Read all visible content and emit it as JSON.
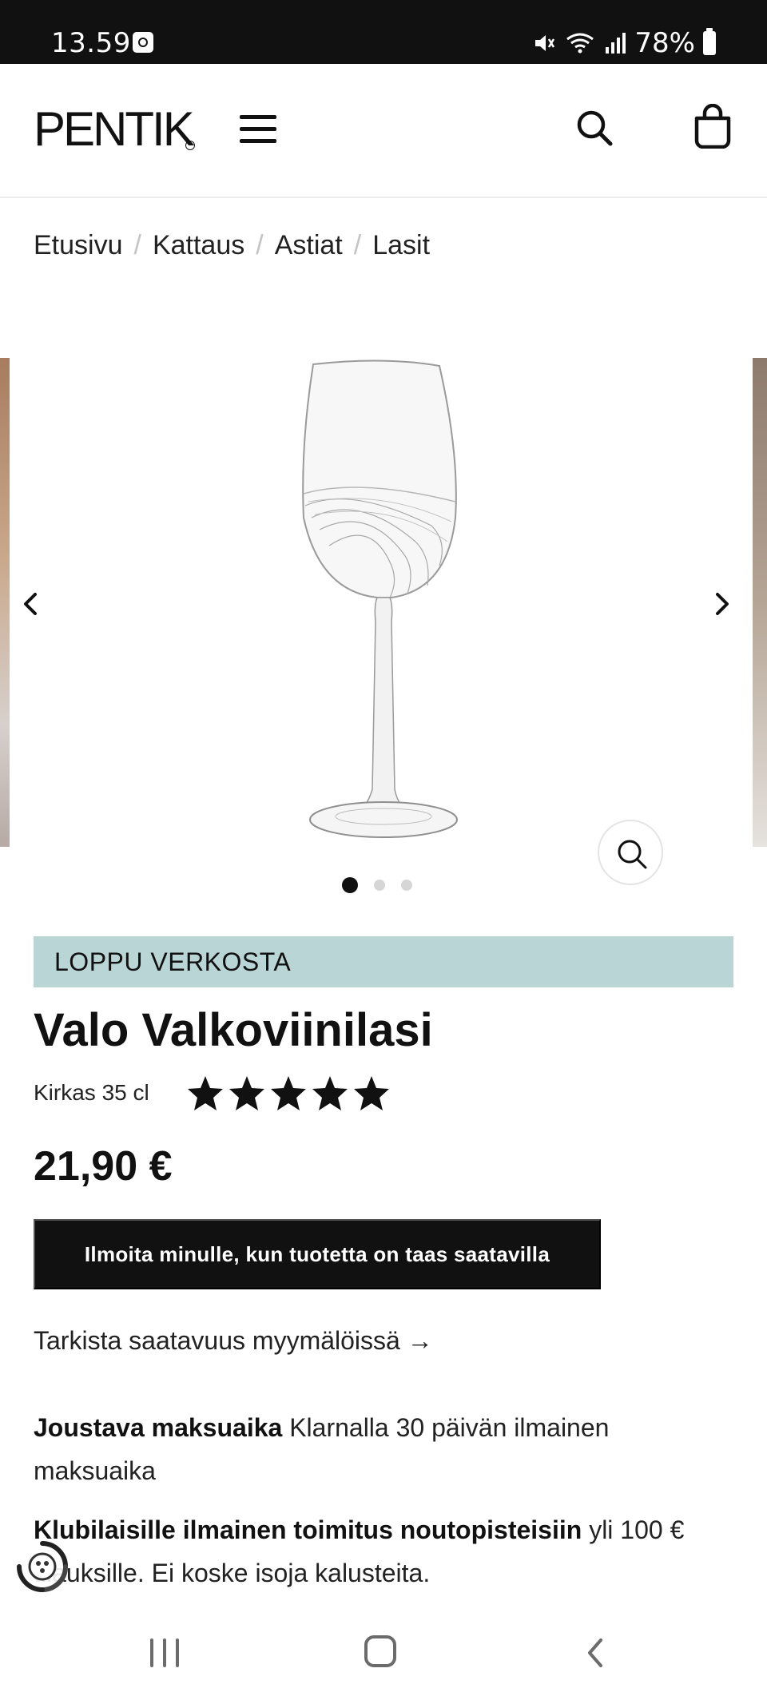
{
  "status_bar": {
    "time": "13.59",
    "battery": "78%"
  },
  "header": {
    "logo": "PENTIK",
    "logo_mark": "®"
  },
  "breadcrumb": {
    "items": [
      "Etusivu",
      "Kattaus",
      "Astiat",
      "Lasit"
    ],
    "separator": "/"
  },
  "gallery": {
    "slide_count": 3,
    "active_slide": 1
  },
  "product": {
    "status_badge": "LOPPU VERKOSTA",
    "title": "Valo Valkoviinilasi",
    "variant": "Kirkas 35 cl",
    "rating": 5,
    "rating_max": 5,
    "price": "21,90 €",
    "notify_button": "Ilmoita minulle, kun tuotetta on taas saatavilla",
    "availability_link": "Tarkista saatavuus myymälöissä →"
  },
  "info": [
    {
      "bold": "Joustava maksuaika",
      "text": " Klarnalla 30 päivän ilmainen maksuaika"
    },
    {
      "bold": "Klubilaisille ilmainen toimitus noutopisteisiin",
      "text": " yli 100 € tilauksille. Ei koske isoja kalusteita."
    }
  ],
  "colors": {
    "status_bar": "#111111",
    "banner": "#bad5d6",
    "button": "#111111",
    "text": "#111111"
  },
  "icons": {
    "menu": "menu-icon",
    "search": "search-icon",
    "cart": "shopping-bag-icon",
    "zoom": "zoom-icon",
    "prev": "chevron-left-icon",
    "next": "chevron-right-icon",
    "chat": "chat-widget-icon"
  }
}
